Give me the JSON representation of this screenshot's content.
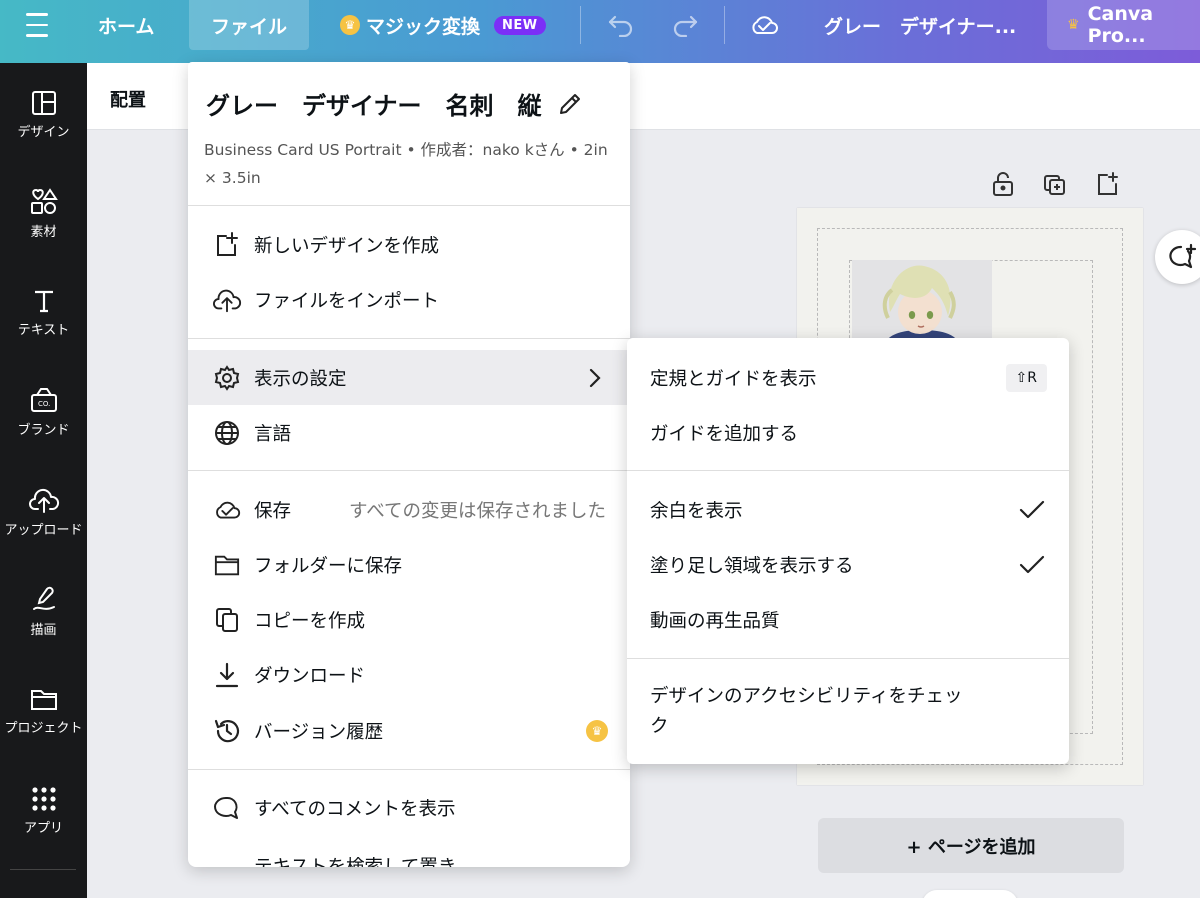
{
  "topbar": {
    "home_label": "ホーム",
    "file_label": "ファイル",
    "magic_label": "マジック変換",
    "new_badge": "NEW",
    "doc_title": "グレー　デザイナー...",
    "pro_label": "Canva Pro..."
  },
  "sidebar": {
    "items": [
      {
        "label": "デザイン",
        "icon": "layout-icon"
      },
      {
        "label": "素材",
        "icon": "elements-icon"
      },
      {
        "label": "テキスト",
        "icon": "text-icon"
      },
      {
        "label": "ブランド",
        "icon": "brand-icon"
      },
      {
        "label": "アップロード",
        "icon": "upload-icon"
      },
      {
        "label": "描画",
        "icon": "draw-icon"
      },
      {
        "label": "プロジェクト",
        "icon": "folder-icon"
      },
      {
        "label": "アプリ",
        "icon": "apps-icon"
      }
    ]
  },
  "toolbar": {
    "align_label": "配置"
  },
  "canvas": {
    "add_page_label": "+ ページを追加"
  },
  "file_menu": {
    "title": "グレー　デザイナー　名刺　縦",
    "meta": "Business Card US Portrait • 作成者：nako kさん • 2in × 3.5in",
    "items": {
      "new_design": "新しいデザインを作成",
      "import_file": "ファイルをインポート",
      "view_settings": "表示の設定",
      "language": "言語",
      "save": "保存",
      "save_status": "すべての変更は保存されました",
      "save_to_folder": "フォルダーに保存",
      "make_copy": "コピーを作成",
      "download": "ダウンロード",
      "version_history": "バージョン履歴",
      "show_comments": "すべてのコメントを表示",
      "find_replace": "テキストを検索して置き"
    }
  },
  "submenu": {
    "show_rulers": "定規とガイドを表示",
    "rulers_shortcut": "⇧R",
    "add_guides": "ガイドを追加する",
    "show_margins": "余白を表示",
    "show_bleed": "塗り足し領域を表示する",
    "video_quality": "動画の再生品質",
    "accessibility_check": "デザインのアクセシビリティをチェック"
  },
  "colors": {
    "topbar_start": "#46b9c6",
    "topbar_end": "#7d5cd9",
    "sidebar_bg": "#18191b",
    "new_badge": "#7b2ff7",
    "crown": "#f6c344"
  }
}
